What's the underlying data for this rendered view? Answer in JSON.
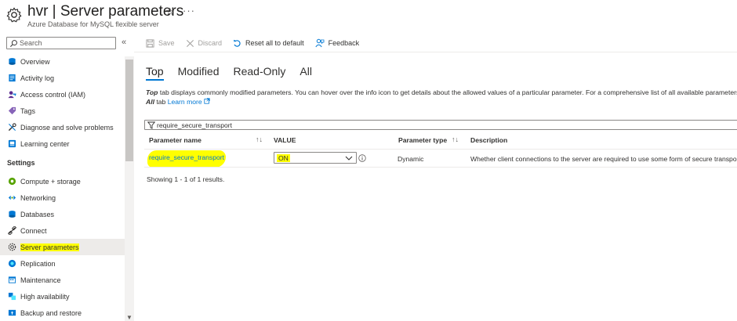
{
  "header": {
    "title": "hvr | Server parameters",
    "subtitle": "Azure Database for MySQL flexible server"
  },
  "sidebar": {
    "search_placeholder": "Search",
    "items_top": [
      {
        "label": "Overview",
        "icon": "mysql-icon"
      },
      {
        "label": "Activity log",
        "icon": "activity-log-icon"
      },
      {
        "label": "Access control (IAM)",
        "icon": "iam-icon"
      },
      {
        "label": "Tags",
        "icon": "tag-icon"
      },
      {
        "label": "Diagnose and solve problems",
        "icon": "wrench-icon"
      },
      {
        "label": "Learning center",
        "icon": "learning-icon"
      }
    ],
    "section_settings": "Settings",
    "items_settings": [
      {
        "label": "Compute + storage",
        "icon": "compute-icon"
      },
      {
        "label": "Networking",
        "icon": "network-icon"
      },
      {
        "label": "Databases",
        "icon": "database-icon"
      },
      {
        "label": "Connect",
        "icon": "connect-icon"
      },
      {
        "label": "Server parameters",
        "icon": "gear-icon",
        "active": true
      },
      {
        "label": "Replication",
        "icon": "replication-icon"
      },
      {
        "label": "Maintenance",
        "icon": "maintenance-icon"
      },
      {
        "label": "High availability",
        "icon": "high-availability-icon"
      },
      {
        "label": "Backup and restore",
        "icon": "backup-icon"
      }
    ]
  },
  "toolbar": {
    "save": "Save",
    "discard": "Discard",
    "reset": "Reset all to default",
    "feedback": "Feedback"
  },
  "tabs": [
    "Top",
    "Modified",
    "Read-Only",
    "All"
  ],
  "active_tab": "Top",
  "description": {
    "part1_bold": "Top",
    "part1": " tab displays commonly modified parameters. You can hover over the info icon to get details about the allowed values of a particular parameter. For a comprehensive list of all available parameters, refer to the",
    "part2_bold": "All",
    "part2": " tab ",
    "learn_more": "Learn more"
  },
  "filter": {
    "value": "require_secure_transport"
  },
  "table": {
    "headers": {
      "name": "Parameter name",
      "value": "VALUE",
      "type": "Parameter type",
      "description": "Description"
    },
    "rows": [
      {
        "name": "require_secure_transport",
        "value": "ON",
        "type": "Dynamic",
        "description": "Whether client connections to the server are required to use some form of secure transport."
      }
    ],
    "footer": "Showing 1 - 1 of 1 results."
  },
  "colors": {
    "accent": "#0078d4",
    "highlight": "#ffff00",
    "active_bg": "#edebe9"
  }
}
